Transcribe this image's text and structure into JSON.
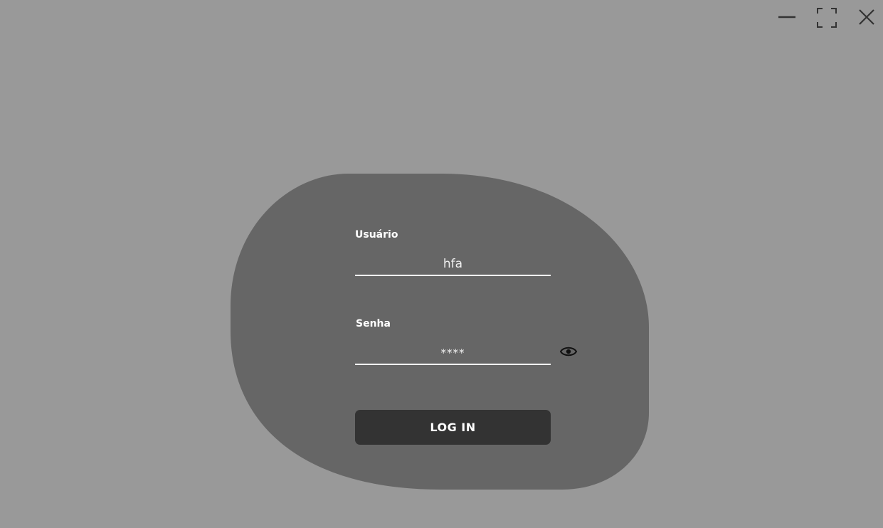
{
  "colors": {
    "background": "#999999",
    "panel": "#666666",
    "button": "#333333",
    "text": "#ffffff"
  },
  "window": {
    "minimize_icon": "minimize-icon",
    "maximize_icon": "maximize-icon",
    "close_icon": "close-icon"
  },
  "login": {
    "username_label": "Usuário",
    "username_value": "hfa",
    "password_label": "Senha",
    "password_value": "****",
    "show_password_icon": "eye-icon",
    "submit_label": "LOG IN"
  }
}
